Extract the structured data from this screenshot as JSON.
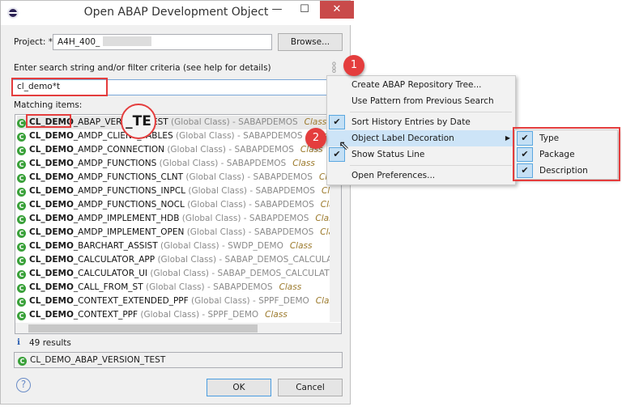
{
  "window": {
    "title": "Open ABAP Development Object",
    "minimize": "—",
    "maximize": "☐",
    "close": "✕"
  },
  "project": {
    "label": "Project: *",
    "value": "A4H_400_",
    "browse": "Browse..."
  },
  "search": {
    "label": "Enter search string and/or filter criteria (see help for details)",
    "value": "cl_demo*t"
  },
  "list": {
    "label": "Matching items:",
    "magnifier_text": "_TE",
    "items": [
      {
        "name": "CL_DEMO",
        "rest": "_ABAP_VERSION_TEST",
        "desc": "(Global Class) - SABAPDEMOS",
        "type": "Class"
      },
      {
        "name": "CL_DEMO",
        "rest": "_AMDP_CLIENT_TABLES",
        "desc": "(Global Class) - SABAPDEMOS",
        "type": "Class"
      },
      {
        "name": "CL_DEMO",
        "rest": "_AMDP_CONNECTION",
        "desc": "(Global Class) - SABAPDEMOS",
        "type": "Class"
      },
      {
        "name": "CL_DEMO",
        "rest": "_AMDP_FUNCTIONS",
        "desc": "(Global Class) - SABAPDEMOS",
        "type": "Class"
      },
      {
        "name": "CL_DEMO",
        "rest": "_AMDP_FUNCTIONS_CLNT",
        "desc": "(Global Class) - SABAPDEMOS",
        "type": "Class"
      },
      {
        "name": "CL_DEMO",
        "rest": "_AMDP_FUNCTIONS_INPCL",
        "desc": "(Global Class) - SABAPDEMOS",
        "type": "Class"
      },
      {
        "name": "CL_DEMO",
        "rest": "_AMDP_FUNCTIONS_NOCL",
        "desc": "(Global Class) - SABAPDEMOS",
        "type": "Class"
      },
      {
        "name": "CL_DEMO",
        "rest": "_AMDP_IMPLEMENT_HDB",
        "desc": "(Global Class) - SABAPDEMOS",
        "type": "Class"
      },
      {
        "name": "CL_DEMO",
        "rest": "_AMDP_IMPLEMENT_OPEN",
        "desc": "(Global Class) - SABAPDEMOS",
        "type": "Class"
      },
      {
        "name": "CL_DEMO",
        "rest": "_BARCHART_ASSIST",
        "desc": "(Global Class) - SWDP_DEMO",
        "type": "Class"
      },
      {
        "name": "CL_DEMO",
        "rest": "_CALCULATOR_APP",
        "desc": "(Global Class) - SABAP_DEMOS_CALCULATOR",
        "type": ""
      },
      {
        "name": "CL_DEMO",
        "rest": "_CALCULATOR_UI",
        "desc": "(Global Class) - SABAP_DEMOS_CALCULATOR",
        "type": "C"
      },
      {
        "name": "CL_DEMO",
        "rest": "_CALL_FROM_ST",
        "desc": "(Global Class) - SABAPDEMOS",
        "type": "Class"
      },
      {
        "name": "CL_DEMO",
        "rest": "_CONTEXT_EXTENDED_PPF",
        "desc": "(Global Class) - SPPF_DEMO",
        "type": "Class"
      },
      {
        "name": "CL_DEMO",
        "rest": "_CONTEXT_PPF",
        "desc": "(Global Class) - SPPF_DEMO",
        "type": "Class"
      }
    ]
  },
  "status": {
    "text": "49 results",
    "selected": "CL_DEMO_ABAP_VERSION_TEST"
  },
  "buttons": {
    "ok": "OK",
    "cancel": "Cancel"
  },
  "menu": {
    "items": [
      {
        "label": "Create ABAP Repository Tree...",
        "checked": false
      },
      {
        "label": "Use Pattern from Previous Search",
        "checked": false
      },
      {
        "label": "Sort History Entries by Date",
        "checked": true
      },
      {
        "label": "Object Label Decoration",
        "checked": false,
        "submenu": true
      },
      {
        "label": "Show Status Line",
        "checked": true
      },
      {
        "label": "Open Preferences...",
        "checked": false
      }
    ]
  },
  "submenu": {
    "items": [
      {
        "label": "Type",
        "checked": true
      },
      {
        "label": "Package",
        "checked": true
      },
      {
        "label": "Description",
        "checked": true
      }
    ]
  },
  "annotations": {
    "badge1": "1",
    "badge2": "2"
  },
  "colors": {
    "accent": "#e43d3d",
    "highlight": "#cde4f7",
    "class_icon": "#3aa13a"
  }
}
